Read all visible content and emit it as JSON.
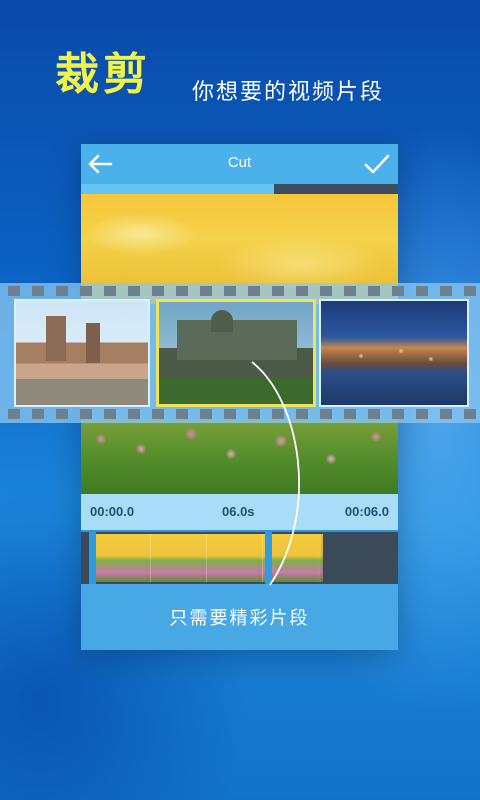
{
  "promo": {
    "headline": "裁剪",
    "tagline": "你想要的视频片段",
    "caption": "只需要精彩片段"
  },
  "appbar": {
    "title": "Cut",
    "back_icon": "arrow-left-icon",
    "confirm_icon": "checkmark-icon"
  },
  "progress": {
    "fraction": 0.61
  },
  "timeline": {
    "start_time": "00:00.0",
    "selected_duration": "06.0s",
    "end_time": "00:06.0"
  },
  "colors": {
    "headline": "#f1f34a",
    "accent": "#4ab1eb",
    "progress_fill": "#66c4f5"
  }
}
